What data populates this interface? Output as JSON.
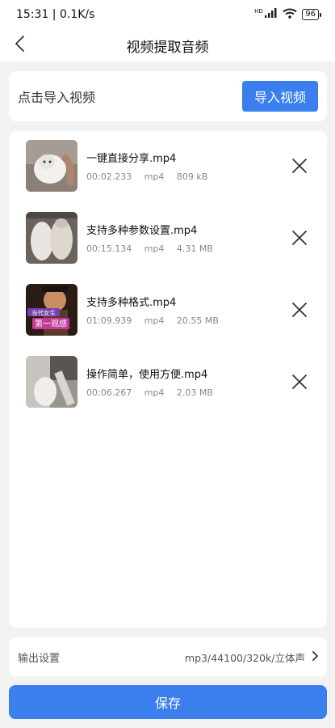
{
  "status_bar": {
    "time_speed": "15:31 | 0.1K/s",
    "network_badge": "HD",
    "battery": "96"
  },
  "header": {
    "title": "视频提取音频"
  },
  "import": {
    "label": "点击导入视频",
    "button": "导入视频"
  },
  "videos": [
    {
      "name": "一键直接分享.mp4",
      "duration": "00:02.233",
      "format": "mp4",
      "size": "809 kB"
    },
    {
      "name": "支持多种参数设置.mp4",
      "duration": "00:15.134",
      "format": "mp4",
      "size": "4.31 MB"
    },
    {
      "name": "支持多种格式.mp4",
      "duration": "01:09.939",
      "format": "mp4",
      "size": "20.55 MB"
    },
    {
      "name": "操作简单，使用方便.mp4",
      "duration": "00:06.267",
      "format": "mp4",
      "size": "2.03 MB"
    }
  ],
  "thumb_text": {
    "line1": "当代女生",
    "line2": "第一观感"
  },
  "output": {
    "label": "输出设置",
    "value": "mp3/44100/320k/立体声"
  },
  "save_button": "保存",
  "colors": {
    "accent": "#3a7fed",
    "background": "#f2f2f2"
  }
}
